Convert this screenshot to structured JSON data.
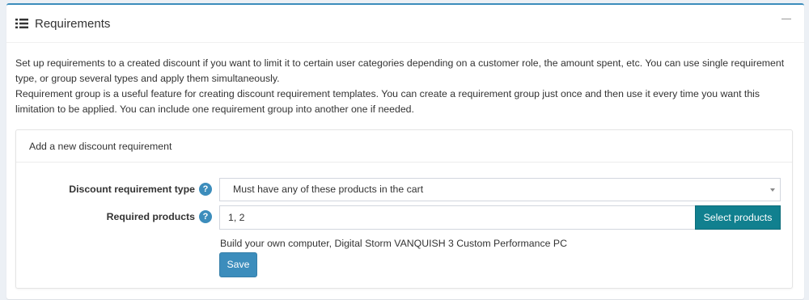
{
  "header": {
    "title": "Requirements",
    "icon": "list-icon"
  },
  "description": {
    "paragraph1": "Set up requirements to a created discount if you want to limit it to certain user categories depending on a customer role, the amount spent, etc. You can use single requirement type, or group several types and apply them simultaneously.",
    "paragraph2": "Requirement group is a useful feature for creating discount requirement templates. You can create a requirement group just once and then use it every time you want this limitation to be applied. You can include one requirement group into another one if needed."
  },
  "add_requirement": {
    "title": "Add a new discount requirement",
    "type_label": "Discount requirement type",
    "type_value": "Must have any of these products in the cart",
    "products_label": "Required products",
    "products_value": "1, 2",
    "select_products_label": "Select products",
    "products_note": "Build your own computer, Digital Storm VANQUISH 3 Custom Performance PC",
    "save_label": "Save",
    "help_glyph": "?"
  },
  "colors": {
    "accent": "#3c8dbc",
    "teal_button": "#11808f"
  }
}
